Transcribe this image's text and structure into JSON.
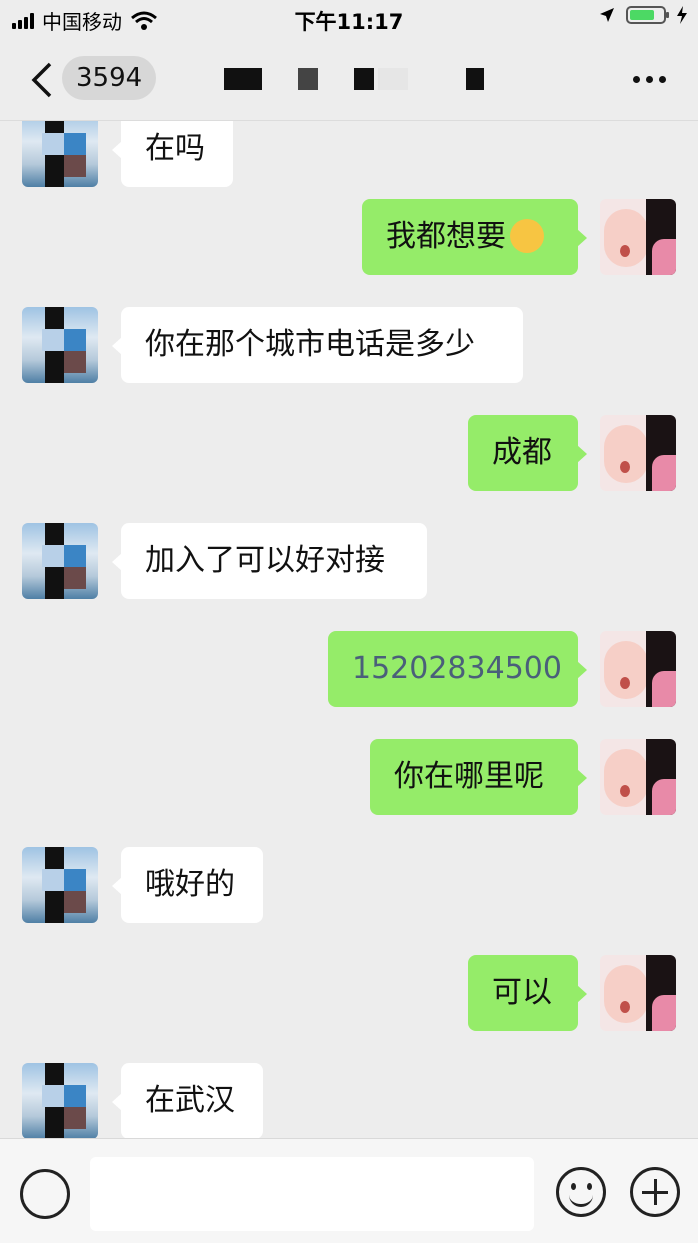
{
  "status_bar": {
    "carrier": "中国移动",
    "time": "下午11:17"
  },
  "nav": {
    "unread_count": "3594"
  },
  "messages": [
    {
      "side": "in",
      "text": "在吗"
    },
    {
      "side": "out",
      "text": "我都想要"
    },
    {
      "side": "in",
      "text": "你在那个城市电话是多少"
    },
    {
      "side": "out",
      "text": "成都"
    },
    {
      "side": "in",
      "text": "加入了可以好对接"
    },
    {
      "side": "out",
      "text": "15202834500"
    },
    {
      "side": "out",
      "text": "你在哪里呢"
    },
    {
      "side": "in",
      "text": "哦好的"
    },
    {
      "side": "out",
      "text": "可以"
    },
    {
      "side": "in",
      "text": "在武汉"
    }
  ],
  "input": {
    "value": ""
  },
  "colors": {
    "background": "#ededed",
    "outgoing_bubble": "#95ec69",
    "incoming_bubble": "#ffffff",
    "phone_link": "#4a5f7a"
  }
}
